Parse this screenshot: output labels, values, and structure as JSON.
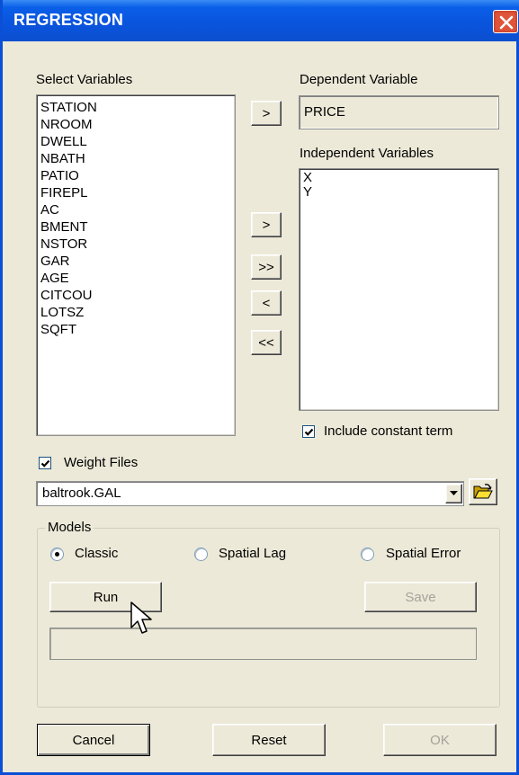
{
  "window": {
    "title": "REGRESSION"
  },
  "select_variables": {
    "label": "Select Variables",
    "items": [
      "STATION",
      "NROOM",
      "DWELL",
      "NBATH",
      "PATIO",
      "FIREPL",
      "AC",
      "BMENT",
      "NSTOR",
      "GAR",
      "AGE",
      "CITCOU",
      "LOTSZ",
      "SQFT"
    ]
  },
  "dependent": {
    "label": "Dependent Variable",
    "value": "PRICE",
    "button": ">"
  },
  "independent": {
    "label": "Independent Variables",
    "items": [
      "X",
      "Y"
    ],
    "buttons": {
      "add": ">",
      "add_all": ">>",
      "remove": "<",
      "remove_all": "<<"
    }
  },
  "include_constant": {
    "label": "Include constant term",
    "checked": true
  },
  "weight_files": {
    "label": "Weight Files",
    "checked": true,
    "value": "baltrook.GAL"
  },
  "models": {
    "label": "Models",
    "options": [
      {
        "label": "Classic",
        "selected": true
      },
      {
        "label": "Spatial Lag",
        "selected": false
      },
      {
        "label": "Spatial Error",
        "selected": false
      }
    ],
    "run_label": "Run",
    "save_label": "Save"
  },
  "footer": {
    "cancel_label": "Cancel",
    "reset_label": "Reset",
    "ok_label": "OK"
  },
  "icons": {
    "close": "close-icon",
    "dropdown": "chevron-down-icon",
    "folder": "open-folder-icon",
    "cursor": "mouse-pointer-icon"
  }
}
